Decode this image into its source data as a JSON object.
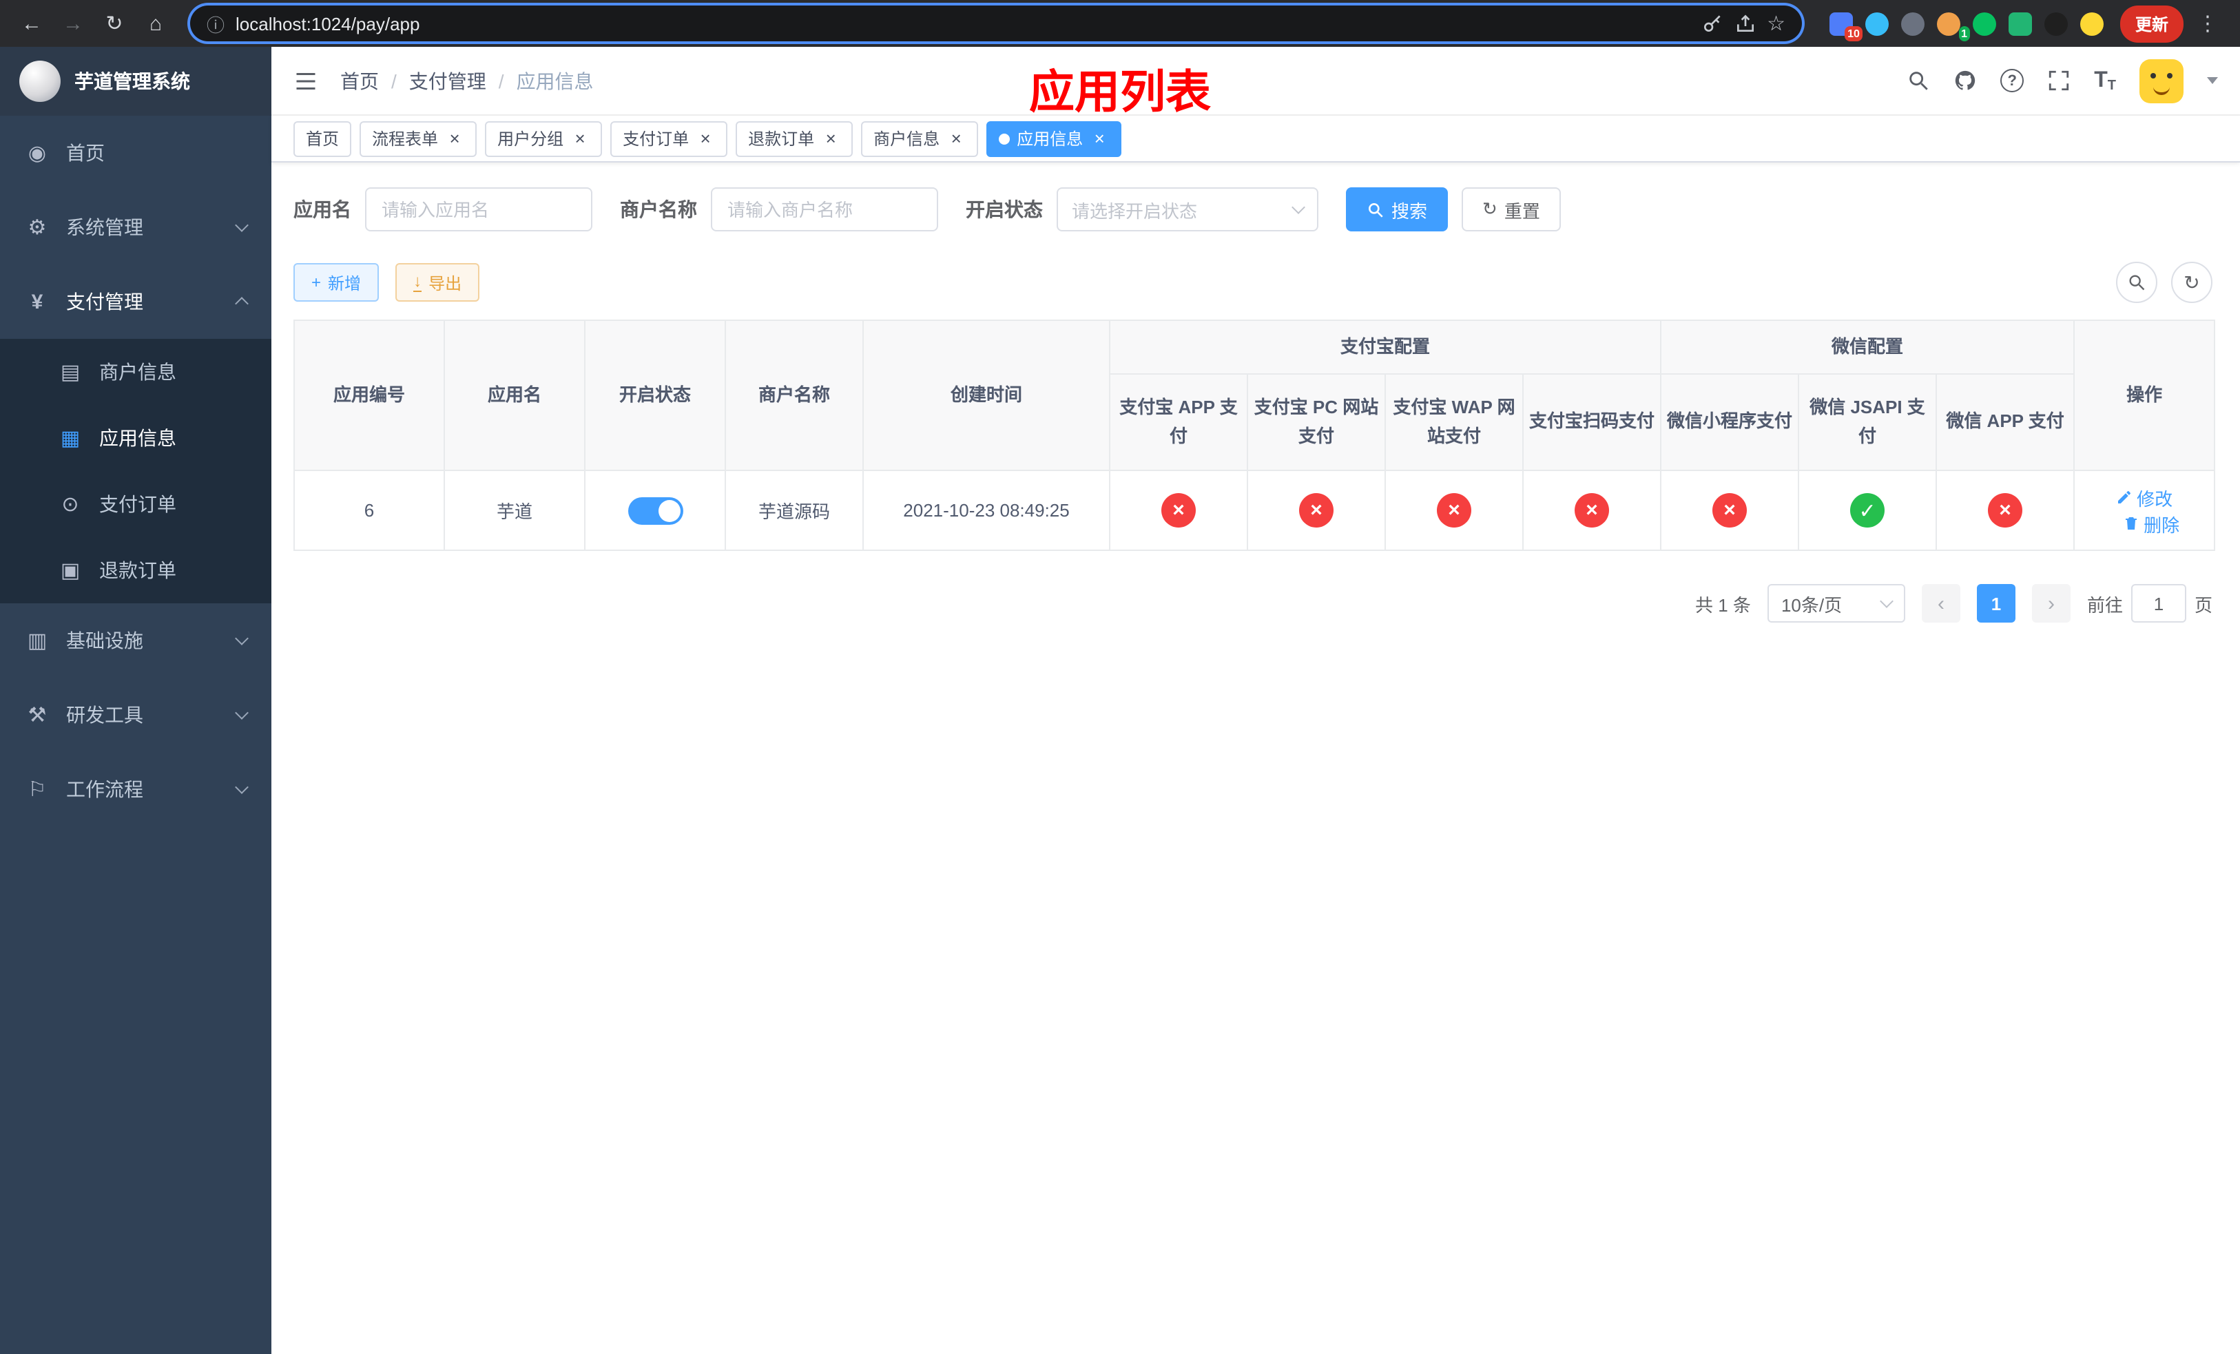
{
  "browser": {
    "url": "localhost:1024/pay/app",
    "update_button": "更新",
    "badges": {
      "extensions": "10",
      "profile": "1"
    }
  },
  "sidebar": {
    "logo_title": "芋道管理系统",
    "menu": [
      {
        "label": "首页"
      },
      {
        "label": "系统管理"
      },
      {
        "label": "支付管理"
      },
      {
        "label": "商户信息"
      },
      {
        "label": "应用信息"
      },
      {
        "label": "支付订单"
      },
      {
        "label": "退款订单"
      },
      {
        "label": "基础设施"
      },
      {
        "label": "研发工具"
      },
      {
        "label": "工作流程"
      }
    ]
  },
  "header": {
    "breadcrumb": [
      "首页",
      "支付管理",
      "应用信息"
    ],
    "page_title": "应用列表"
  },
  "tabs": [
    {
      "label": "首页"
    },
    {
      "label": "流程表单"
    },
    {
      "label": "用户分组"
    },
    {
      "label": "支付订单"
    },
    {
      "label": "退款订单"
    },
    {
      "label": "商户信息"
    },
    {
      "label": "应用信息"
    }
  ],
  "filters": {
    "app_name_label": "应用名",
    "app_name_placeholder": "请输入应用名",
    "merchant_label": "商户名称",
    "merchant_placeholder": "请输入商户名称",
    "status_label": "开启状态",
    "status_placeholder": "请选择开启状态",
    "search_button": "搜索",
    "reset_button": "重置"
  },
  "toolbar": {
    "add_button": "新增",
    "export_button": "导出"
  },
  "table": {
    "alipay_group": "支付宝配置",
    "wechat_group": "微信配置",
    "col_app_id": "应用编号",
    "col_app_name": "应用名",
    "col_status": "开启状态",
    "col_merchant": "商户名称",
    "col_created": "创建时间",
    "col_alipay_app": "支付宝 APP 支付",
    "col_alipay_pc": "支付宝 PC 网站支付",
    "col_alipay_wap": "支付宝 WAP 网站支付",
    "col_alipay_qr": "支付宝扫码支付",
    "col_wx_mini": "微信小程序支付",
    "col_wx_jsapi": "微信 JSAPI 支付",
    "col_wx_app": "微信 APP 支付",
    "col_actions": "操作",
    "rows": [
      {
        "id": "6",
        "name": "芋道",
        "enabled": true,
        "merchant": "芋道源码",
        "created_at": "2021-10-23 08:49:25",
        "alipay_app": false,
        "alipay_pc": false,
        "alipay_wap": false,
        "alipay_qr": false,
        "wx_mini": false,
        "wx_jsapi": true,
        "wx_app": false,
        "edit_label": "修改",
        "delete_label": "删除"
      }
    ]
  },
  "pagination": {
    "total_text": "共 1 条",
    "page_size": "10条/页",
    "current_page": "1",
    "goto_prefix": "前往",
    "goto_value": "1",
    "goto_suffix": "页"
  },
  "colors": {
    "primary": "#409eff",
    "danger": "#f53f3f",
    "success": "#26bf4e",
    "title_red": "#ff0000"
  }
}
